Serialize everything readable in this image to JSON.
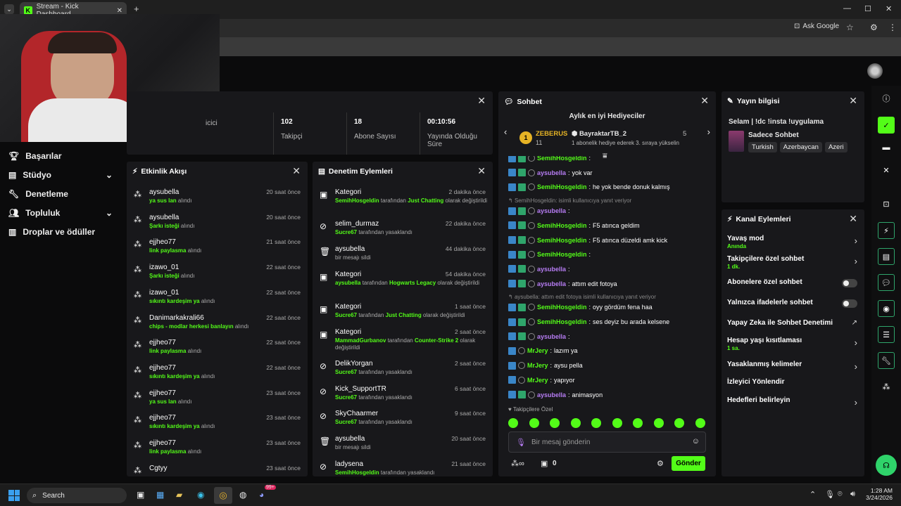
{
  "browser": {
    "tab_title": "Stream - Kick Dashboard",
    "ask_google": "Ask Google"
  },
  "sidebar": {
    "items": [
      {
        "label": "Başarılar",
        "icon": "trophy-icon"
      },
      {
        "label": "Stüdyo",
        "icon": "studio-icon"
      },
      {
        "label": "Denetleme",
        "icon": "wrench-icon"
      },
      {
        "label": "Topluluk",
        "icon": "users-icon"
      },
      {
        "label": "Droplar ve ödüller",
        "icon": "gift-icon"
      }
    ]
  },
  "stats": [
    {
      "value": "",
      "label": "icici"
    },
    {
      "value": "102",
      "label": "Takipçi"
    },
    {
      "value": "18",
      "label": "Abone Sayısı"
    },
    {
      "value": "00:10:56",
      "label": "Yayında Olduğu Süre"
    }
  ],
  "activity": {
    "title": "Etkinlik Akışı",
    "items": [
      {
        "user": "aysubella",
        "time": "20 saat önce",
        "highlight": "ya sus lan",
        "rest": " alındı"
      },
      {
        "user": "aysubella",
        "time": "20 saat önce",
        "highlight": "Şarkı isteği",
        "rest": " alındı"
      },
      {
        "user": "ejjheo77",
        "time": "21 saat önce",
        "highlight": "link paylasma",
        "rest": " alındı"
      },
      {
        "user": "izawo_01",
        "time": "22 saat önce",
        "highlight": "Şarkı isteği",
        "rest": " alındı"
      },
      {
        "user": "izawo_01",
        "time": "22 saat önce",
        "highlight": "sıkıntı kardeşim ya",
        "rest": " alındı"
      },
      {
        "user": "Danimarkakrali66",
        "time": "22 saat önce",
        "highlight": "chips - modlar herkesi banlayın",
        "rest": " alındı"
      },
      {
        "user": "ejjheo77",
        "time": "22 saat önce",
        "highlight": "link paylasma",
        "rest": " alındı"
      },
      {
        "user": "ejjheo77",
        "time": "22 saat önce",
        "highlight": "sıkıntı kardeşim ya",
        "rest": " alındı"
      },
      {
        "user": "ejjheo77",
        "time": "23 saat önce",
        "highlight": "ya sus lan",
        "rest": " alındı"
      },
      {
        "user": "ejjheo77",
        "time": "23 saat önce",
        "highlight": "sıkıntı kardeşim ya",
        "rest": " alındı"
      },
      {
        "user": "ejjheo77",
        "time": "23 saat önce",
        "highlight": "link paylasma",
        "rest": " alındı"
      },
      {
        "user": "Cgtyy",
        "time": "23 saat önce",
        "highlight": "",
        "rest": ""
      }
    ]
  },
  "moderation": {
    "title": "Denetim Eylemleri",
    "items": [
      {
        "icon": "category-icon",
        "title": "Kategori",
        "time": "2 dakika önce",
        "a": "SemihHosgeldin",
        "b": " tarafından ",
        "c": "Just Chatting",
        "d": " olarak değiştirildi"
      },
      {
        "icon": "ban-icon",
        "title": "selim_durmaz",
        "time": "22 dakika önce",
        "a": "Sucre67",
        "b": " tarafından yasaklandı",
        "c": "",
        "d": ""
      },
      {
        "icon": "trash-icon",
        "title": "aysubella",
        "time": "44 dakika önce",
        "a": "",
        "b": "bir mesajı sildi",
        "c": "",
        "d": ""
      },
      {
        "icon": "category-icon",
        "title": "Kategori",
        "time": "54 dakika önce",
        "a": "aysubella",
        "b": " tarafından ",
        "c": "Hogwarts Legacy",
        "d": " olarak değiştirildi"
      },
      {
        "icon": "category-icon",
        "title": "Kategori",
        "time": "1 saat önce",
        "a": "Sucre67",
        "b": " tarafından ",
        "c": "Just Chatting",
        "d": " olarak değiştirildi"
      },
      {
        "icon": "category-icon",
        "title": "Kategori",
        "time": "2 saat önce",
        "a": "MammadGurbanov",
        "b": " tarafından ",
        "c": "Counter-Strike 2",
        "d": " olarak değiştirildi"
      },
      {
        "icon": "ban-icon",
        "title": "DelikYorgan",
        "time": "2 saat önce",
        "a": "Sucre67",
        "b": " tarafından yasaklandı",
        "c": "",
        "d": ""
      },
      {
        "icon": "ban-icon",
        "title": "Kick_SupportTR",
        "time": "6 saat önce",
        "a": "Sucre67",
        "b": " tarafından yasaklandı",
        "c": "",
        "d": ""
      },
      {
        "icon": "ban-icon",
        "title": "SkyChaarmer",
        "time": "9 saat önce",
        "a": "Sucre67",
        "b": " tarafından yasaklandı",
        "c": "",
        "d": ""
      },
      {
        "icon": "trash-icon",
        "title": "aysubella",
        "time": "20 saat önce",
        "a": "",
        "b": "bir mesajı sildi",
        "c": "",
        "d": ""
      },
      {
        "icon": "ban-icon",
        "title": "ladysena",
        "time": "21 saat önce",
        "a": "SemihHosgeldin",
        "b": " tarafından yasaklandı",
        "c": "",
        "d": ""
      }
    ]
  },
  "chat": {
    "title": "Sohbet",
    "gifters_title": "Aylık en iyi Hediyeciler",
    "gifter1_name": "ZEBERUS",
    "gifter1_count": "11",
    "gifter1_rank": "1",
    "gifter2_name": "BayraktarTB_2",
    "gifter2_count": "5",
    "gifter2_note": "1 abonelik hediye ederek 3. sıraya yükselin",
    "lines": [
      {
        "user": "SemihHosgeldin",
        "ucls": "u1",
        "msg": "",
        "b": 2
      },
      {
        "user": "aysubella",
        "ucls": "u2",
        "msg": "yok var",
        "b": 3
      },
      {
        "user": "SemihHosgeldin",
        "ucls": "u1",
        "msg": "he yok bende donuk kalmış",
        "b": 2
      },
      {
        "reply": "SemihHosgeldin: isimli kullanıcıya yanıt veriyor"
      },
      {
        "user": "aysubella",
        "ucls": "u2",
        "msg": "",
        "b": 3
      },
      {
        "user": "SemihHosgeldin",
        "ucls": "u1",
        "msg": "F5 atınca geldim",
        "b": 2
      },
      {
        "user": "SemihHosgeldin",
        "ucls": "u1",
        "msg": "F5 atınca düzeldi amk kick",
        "b": 2
      },
      {
        "user": "SemihHosgeldin",
        "ucls": "u1",
        "msg": "",
        "b": 2
      },
      {
        "user": "aysubella",
        "ucls": "u2",
        "msg": "",
        "b": 3
      },
      {
        "user": "aysubella",
        "ucls": "u2",
        "msg": "attım edit fotoya",
        "b": 3
      },
      {
        "reply": "aysubella: attım edit fotoya isimli kullanıcıya yanıt veriyor"
      },
      {
        "user": "SemihHosgeldin",
        "ucls": "u1",
        "msg": "oyy gördüm fena haa",
        "b": 2
      },
      {
        "user": "SemihHosgeldin",
        "ucls": "u1",
        "msg": "ses deyiz bu arada kelsene",
        "b": 2
      },
      {
        "user": "aysubella",
        "ucls": "u2",
        "msg": "",
        "b": 3
      },
      {
        "user": "MrJery",
        "ucls": "u3",
        "msg": "lazım ya",
        "b": 1
      },
      {
        "user": "MrJery",
        "ucls": "u3",
        "msg": "aysu pella",
        "b": 1
      },
      {
        "user": "MrJery",
        "ucls": "u3",
        "msg": "yapıyor",
        "b": 1
      },
      {
        "user": "aysubella",
        "ucls": "u2",
        "msg": "animasyon",
        "b": 3
      }
    ],
    "followers_label": "Takipçilere Özel",
    "input_placeholder": "Bir mesaj gönderin",
    "send_label": "Gönder",
    "points": "0"
  },
  "stream_info": {
    "title": "Yayın bilgisi",
    "stream_title": "Selam | !dc !insta !uygulama",
    "category": "Sadece Sohbet",
    "tags": [
      "Turkish",
      "Azerbaycan",
      "Azeri"
    ]
  },
  "channel_actions": {
    "title": "Kanal Eylemleri",
    "items": [
      {
        "label": "Yavaş mod",
        "sub": "Anında",
        "kind": "chev"
      },
      {
        "label": "Takipçilere özel sohbet",
        "sub": "1 dk.",
        "kind": "chev"
      },
      {
        "label": "Abonelere özel sohbet",
        "sub": "",
        "kind": "toggle"
      },
      {
        "label": "Yalnızca ifadelerle sohbet",
        "sub": "",
        "kind": "toggle"
      },
      {
        "label": "Yapay Zeka ile Sohbet Denetimi",
        "sub": "",
        "kind": "ext"
      },
      {
        "label": "Hesap yaşı kısıtlaması",
        "sub": "1 sa.",
        "kind": "chev"
      },
      {
        "label": "Yasaklanmış kelimeler",
        "sub": "",
        "kind": "chev"
      },
      {
        "label": "İzleyici Yönlendir",
        "sub": "",
        "kind": "none"
      },
      {
        "label": "Hedefleri belirleyin",
        "sub": "",
        "kind": "chev"
      }
    ]
  },
  "taskbar": {
    "search": "Search",
    "time": "1:28 AM",
    "date": "3/24/2026",
    "badge": "99+"
  },
  "colors": {
    "accent": "#53fc18",
    "panel": "#18181b",
    "bg": "#0b0b0c"
  }
}
